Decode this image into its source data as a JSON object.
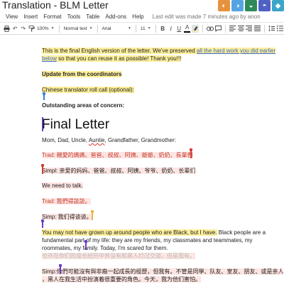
{
  "title": {
    "doc_title": "Translation - BLM Letter",
    "star": "☆",
    "folder": "▭"
  },
  "colors": {
    "highlight_yellow": "#fdef9b",
    "highlight_pink": "#fde5e2",
    "link_blue": "#3b68c6",
    "chinese_red": "#c63c2d",
    "avatar_colors": [
      "#e7913d",
      "#54a4e4",
      "#2e8a57",
      "#5061c4",
      "#3ba5c9"
    ]
  },
  "avatars": [
    {
      "icon": "walrus-icon",
      "glyph": "◐"
    },
    {
      "icon": "penguin-icon",
      "glyph": "◑"
    },
    {
      "icon": "turtle-icon",
      "glyph": "◒"
    },
    {
      "icon": "kraken-icon",
      "glyph": "◓"
    },
    {
      "icon": "bird-icon",
      "glyph": "◆"
    }
  ],
  "menu": {
    "items": [
      "View",
      "Insert",
      "Format",
      "Tools",
      "Table",
      "Add-ons",
      "Help"
    ],
    "last_edit": "Last edit was made 7 minutes ago by anon"
  },
  "toolbar": {
    "zoom": "100%",
    "style": "Normal text",
    "font": "Arial",
    "size": "11",
    "bold": "B",
    "italic": "I",
    "underline": "U",
    "text_color": "A"
  },
  "doc": {
    "intro_before_link": "This is the final English version of the letter. We've preserved ",
    "intro_link_line1": "all the hard work you did earlier",
    "intro_link_line2": "below",
    "intro_after_link": " so that you can reuse it as possible! Thank you!!!",
    "update_heading": "Update from the coordinators",
    "roll_call": "Chinese translator roll call (optional):",
    "concerns": "Outstanding areas of concern:",
    "final_title": "Final Letter",
    "family_prefix": "Mom, Dad, Uncle, ",
    "family_auntie": "Auntie",
    "family_suffix": ", Grandfather, Grandmother:",
    "trad_family": "Trad: 親愛的媽媽、爸爸、叔叔、阿姨、爺爺、奶奶、長輩們",
    "simpl_family": "Simpl: 亲爱的妈妈、爸爸、叔叔、阿姨、爷爷、奶奶、长辈们",
    "need_talk": "We need to talk.",
    "trad_talk": "Trad: 我們得談談。",
    "simp_talk": "Simp: 我们得谈谈。",
    "black_line1_hl": "You may not have grown up around people who are Black, but I have.",
    "black_line1_rest": " Black people are a",
    "black_line2": "fundamental part of my life: they are my friends, my classmates and teammates, my",
    "black_line3": "roommates, my family. Today, I'm scared for them.",
    "black_line4_cn": "也许在你们的成长经历中并没有和黑人打过交道，但是我有。",
    "simp_long_line1": "Simp:你們可能沒有與非裔一起成長的經歷，但我有。不管是同學、队友、室友、朋友、或是亲人",
    "simp_long_line2": "，黑人在我生活中扮演着很重要的角色。今天，我为他们害怕。"
  }
}
